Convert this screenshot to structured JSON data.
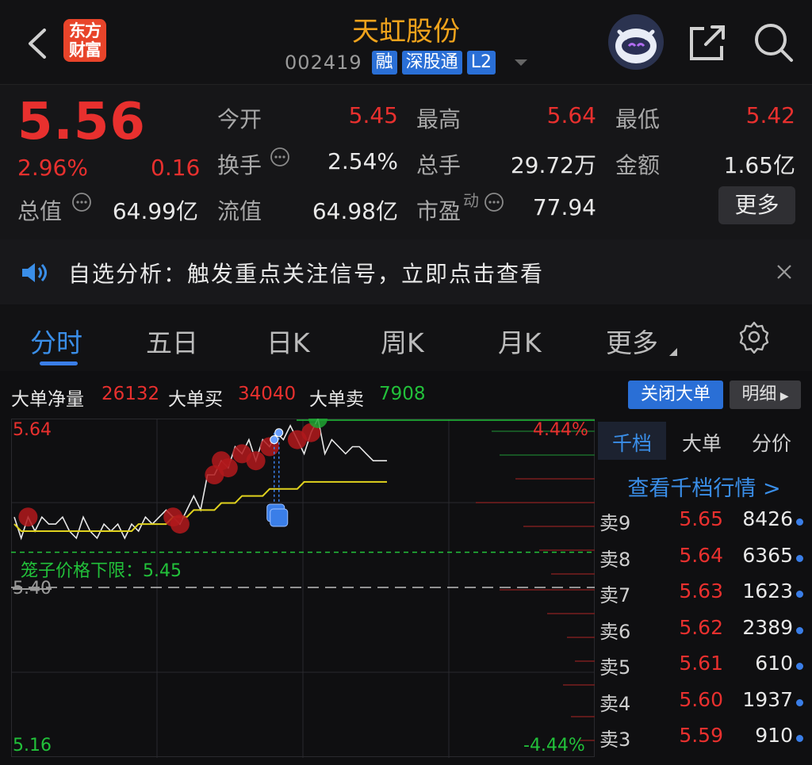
{
  "header": {
    "logo_line1": "东方",
    "logo_line2": "财富",
    "title": "天虹股份",
    "code": "002419",
    "tags": [
      "融",
      "深股通",
      "L2"
    ]
  },
  "quote": {
    "price": "5.56",
    "change_pct": "2.96%",
    "change_abs": "0.16",
    "rows": [
      [
        {
          "label": "今开",
          "value": "5.45",
          "color": "red"
        },
        {
          "label": "最高",
          "value": "5.64",
          "color": "red"
        },
        {
          "label": "最低",
          "value": "5.42",
          "color": "red"
        }
      ],
      [
        {
          "label": "换手",
          "value": "2.54%",
          "color": "white",
          "info": true
        },
        {
          "label": "总手",
          "value": "29.72万",
          "color": "white"
        },
        {
          "label": "金额",
          "value": "1.65亿",
          "color": "white"
        }
      ],
      [
        {
          "label": "流值",
          "value": "64.98亿",
          "color": "white"
        },
        {
          "label": "市盈",
          "sup": "动",
          "value": "77.94",
          "color": "white",
          "info": true
        }
      ]
    ],
    "total_value_label": "总值",
    "total_value": "64.99亿",
    "more_label": "更多"
  },
  "notice": {
    "text": "自选分析：触发重点关注信号，立即点击查看"
  },
  "tabs": [
    "分时",
    "五日",
    "日K",
    "周K",
    "月K",
    "更多"
  ],
  "big_order": {
    "net_label": "大单净量",
    "net_value": "26132",
    "buy_label": "大单买",
    "buy_value": "34040",
    "sell_label": "大单卖",
    "sell_value": "7908",
    "close_label": "关闭大单",
    "detail_label": "明细"
  },
  "chart_data": {
    "type": "line",
    "ylim": [
      5.16,
      5.64
    ],
    "y_top_label": "5.64",
    "y_bottom_label": "5.16",
    "pct_top": "4.44%",
    "pct_bottom": "-4.44%",
    "prev_close_label": "5.40",
    "limit_label": "笼子价格下限：5.45",
    "limit_value": 5.45,
    "prev_close": 5.4,
    "series": [
      {
        "values": [
          5.5,
          5.47,
          5.5,
          5.48,
          5.5,
          5.49,
          5.49,
          5.5,
          5.48,
          5.47,
          5.5,
          5.48,
          5.47,
          5.49,
          5.48,
          5.49,
          5.47,
          5.49,
          5.48,
          5.5,
          5.49,
          5.5,
          5.51,
          5.5,
          5.49,
          5.51,
          5.53,
          5.51,
          5.56,
          5.56,
          5.58,
          5.57,
          5.6,
          5.59,
          5.61,
          5.58,
          5.61,
          5.6,
          5.62,
          5.61,
          5.63,
          5.61,
          5.59,
          5.62,
          5.64,
          5.59,
          5.61,
          5.6,
          5.59,
          5.6,
          5.6,
          5.59,
          5.58,
          5.58,
          5.58
        ]
      },
      {
        "values": [
          5.49,
          5.48,
          5.48,
          5.48,
          5.48,
          5.48,
          5.48,
          5.48,
          5.48,
          5.48,
          5.48,
          5.48,
          5.48,
          5.48,
          5.48,
          5.48,
          5.48,
          5.48,
          5.49,
          5.49,
          5.49,
          5.49,
          5.49,
          5.5,
          5.5,
          5.5,
          5.51,
          5.51,
          5.51,
          5.51,
          5.52,
          5.52,
          5.52,
          5.53,
          5.53,
          5.53,
          5.53,
          5.54,
          5.54,
          5.54,
          5.54,
          5.54,
          5.55,
          5.55,
          5.55,
          5.55,
          5.55,
          5.55,
          5.55,
          5.55,
          5.55,
          5.55,
          5.55,
          5.55,
          5.55
        ]
      }
    ]
  },
  "order_book": {
    "tabs": [
      "千档",
      "大单",
      "分价"
    ],
    "view_link": "查看千档行情 >",
    "rows": [
      {
        "label": "卖9",
        "price": "5.65",
        "volume": "8426"
      },
      {
        "label": "卖8",
        "price": "5.64",
        "volume": "6365"
      },
      {
        "label": "卖7",
        "price": "5.63",
        "volume": "1623"
      },
      {
        "label": "卖6",
        "price": "5.62",
        "volume": "2389"
      },
      {
        "label": "卖5",
        "price": "5.61",
        "volume": "610"
      },
      {
        "label": "卖4",
        "price": "5.60",
        "volume": "1937"
      },
      {
        "label": "卖3",
        "price": "5.59",
        "volume": "910"
      }
    ]
  },
  "colors": {
    "up": "#e8302e",
    "down": "#22c13a",
    "accent": "#2a6fd6",
    "avg": "#e0d21e",
    "title": "#f0a31c"
  }
}
